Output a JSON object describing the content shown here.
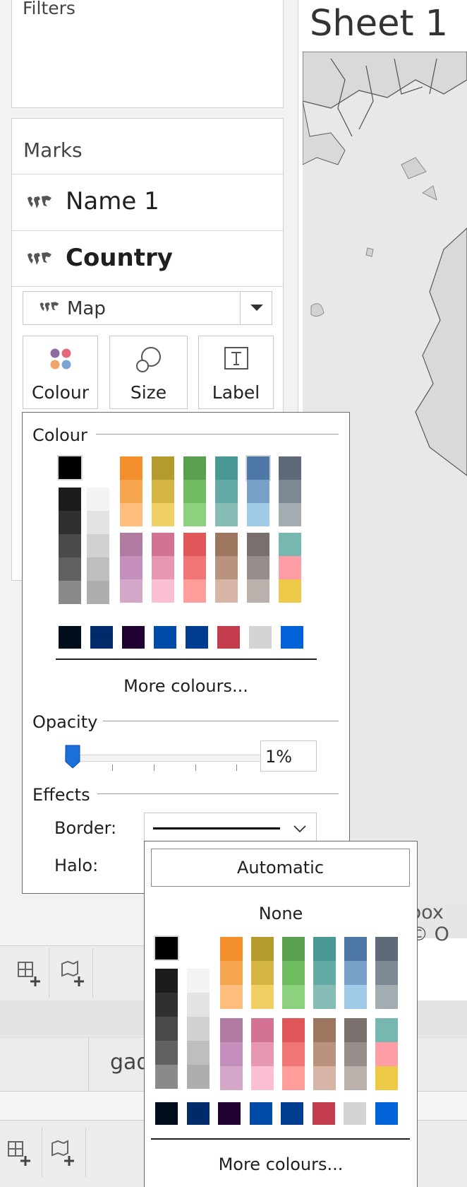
{
  "sheet": {
    "title": "Sheet 1",
    "attribution": "box © O"
  },
  "filters": {
    "title": "Filters"
  },
  "marks": {
    "title": "Marks",
    "fields": [
      {
        "label": "Name 1",
        "bold": false
      },
      {
        "label": "Country",
        "bold": true
      }
    ],
    "mark_type": "Map",
    "buttons": {
      "colour": "Colour",
      "size": "Size",
      "label": "Label"
    }
  },
  "colour_popup": {
    "section_colour": "Colour",
    "more_colours": "More colours...",
    "section_opacity": "Opacity",
    "opacity_value": "1%",
    "opacity_fraction": 0.01,
    "section_effects": "Effects",
    "border_label": "Border:",
    "halo_label": "Halo:"
  },
  "border_dropdown": {
    "automatic": "Automatic",
    "none": "None",
    "more_colours": "More colours..."
  },
  "bottom_tab": {
    "label": "gad"
  },
  "palette": {
    "top_row": [
      "#000000",
      "#ffffff"
    ],
    "gray_dark": [
      "#1c1c1c",
      "#303030",
      "#4a4a4a",
      "#616161",
      "#8a8a8a"
    ],
    "gray_light": [
      "#f3f3f3",
      "#e3e3e3",
      "#d1d1d1",
      "#bebebe",
      "#aeaeae"
    ],
    "hue_top": [
      [
        "#f28e2b",
        "#f6a54f",
        "#ffbe7d"
      ],
      [
        "#b59a2c",
        "#d4b442",
        "#f0d063"
      ],
      [
        "#59a14f",
        "#6fbb60",
        "#8cd17d"
      ],
      [
        "#499894",
        "#62aaa5",
        "#86bcb6"
      ],
      [
        "#4e79a7",
        "#79a0c8",
        "#a0cbe8"
      ],
      [
        "#5e6a78",
        "#7d8894",
        "#a3acb0"
      ]
    ],
    "hue_bottom": [
      [
        "#b07aa1",
        "#c48fbd",
        "#d4a6c8"
      ],
      [
        "#d37295",
        "#e797b2",
        "#fabfd2"
      ],
      [
        "#e15759",
        "#f07575",
        "#ff9d9a"
      ],
      [
        "#9d7660",
        "#b9937e",
        "#d7b5a6"
      ],
      [
        "#79706e",
        "#978d8a",
        "#bab0ac"
      ],
      [
        "#76b7b2",
        "#ff9da7",
        "#edc948"
      ]
    ],
    "bottom_row": [
      "#000d1a",
      "#002b6b",
      "#1f0030",
      "#004aa8",
      "#003c8f",
      "#c43d4c",
      "#d4d4d4",
      "#0062d6"
    ]
  }
}
